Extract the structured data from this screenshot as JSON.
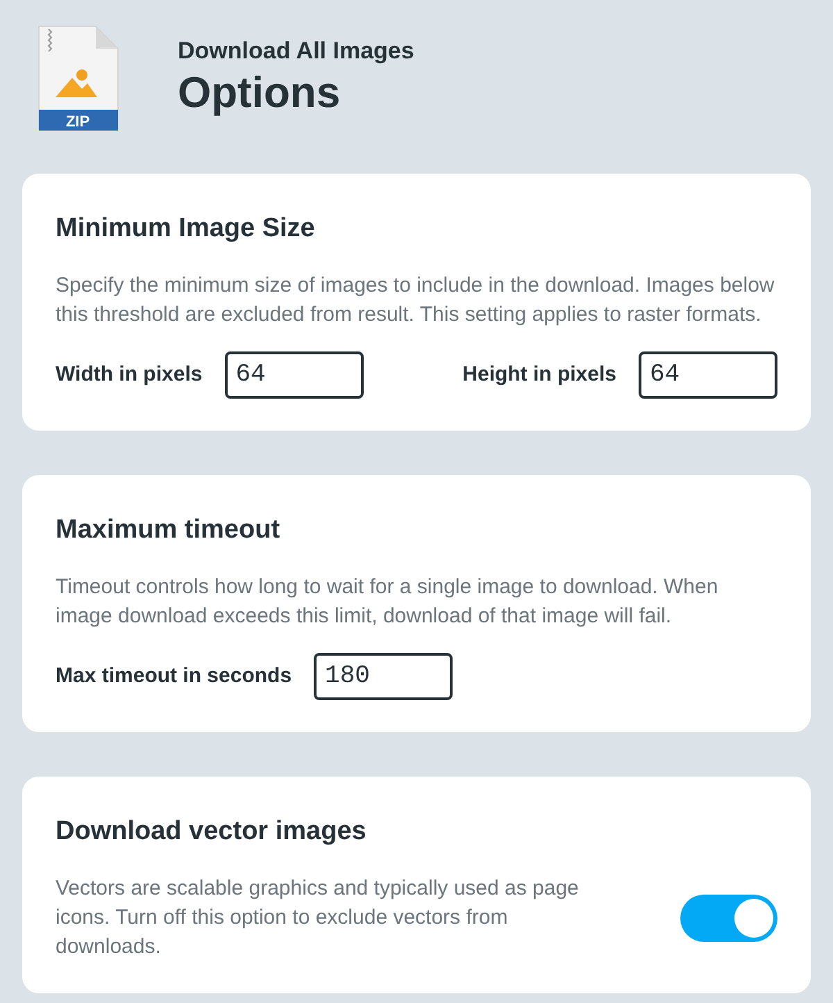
{
  "header": {
    "subtitle": "Download All Images",
    "title": "Options",
    "icon_label": "ZIP"
  },
  "sections": [
    {
      "kind": "fields",
      "title": "Minimum Image Size",
      "description": "Specify the minimum size of images to include in the download. Images below this threshold are excluded from result. This setting applies to raster formats.",
      "fields": [
        {
          "label": "Width in pixels",
          "value": "64"
        },
        {
          "label": "Height in pixels",
          "value": "64"
        }
      ]
    },
    {
      "kind": "fields",
      "title": "Maximum timeout",
      "description": "Timeout controls how long to wait for a single image to download. When image download exceeds this limit, download of that image will fail.",
      "fields": [
        {
          "label": "Max timeout in seconds",
          "value": "180"
        }
      ]
    },
    {
      "kind": "toggle",
      "title": "Download vector images",
      "description": "Vectors are scalable graphics and typically used as page icons. Turn off this option to exclude vectors from downloads.",
      "on": true
    }
  ]
}
